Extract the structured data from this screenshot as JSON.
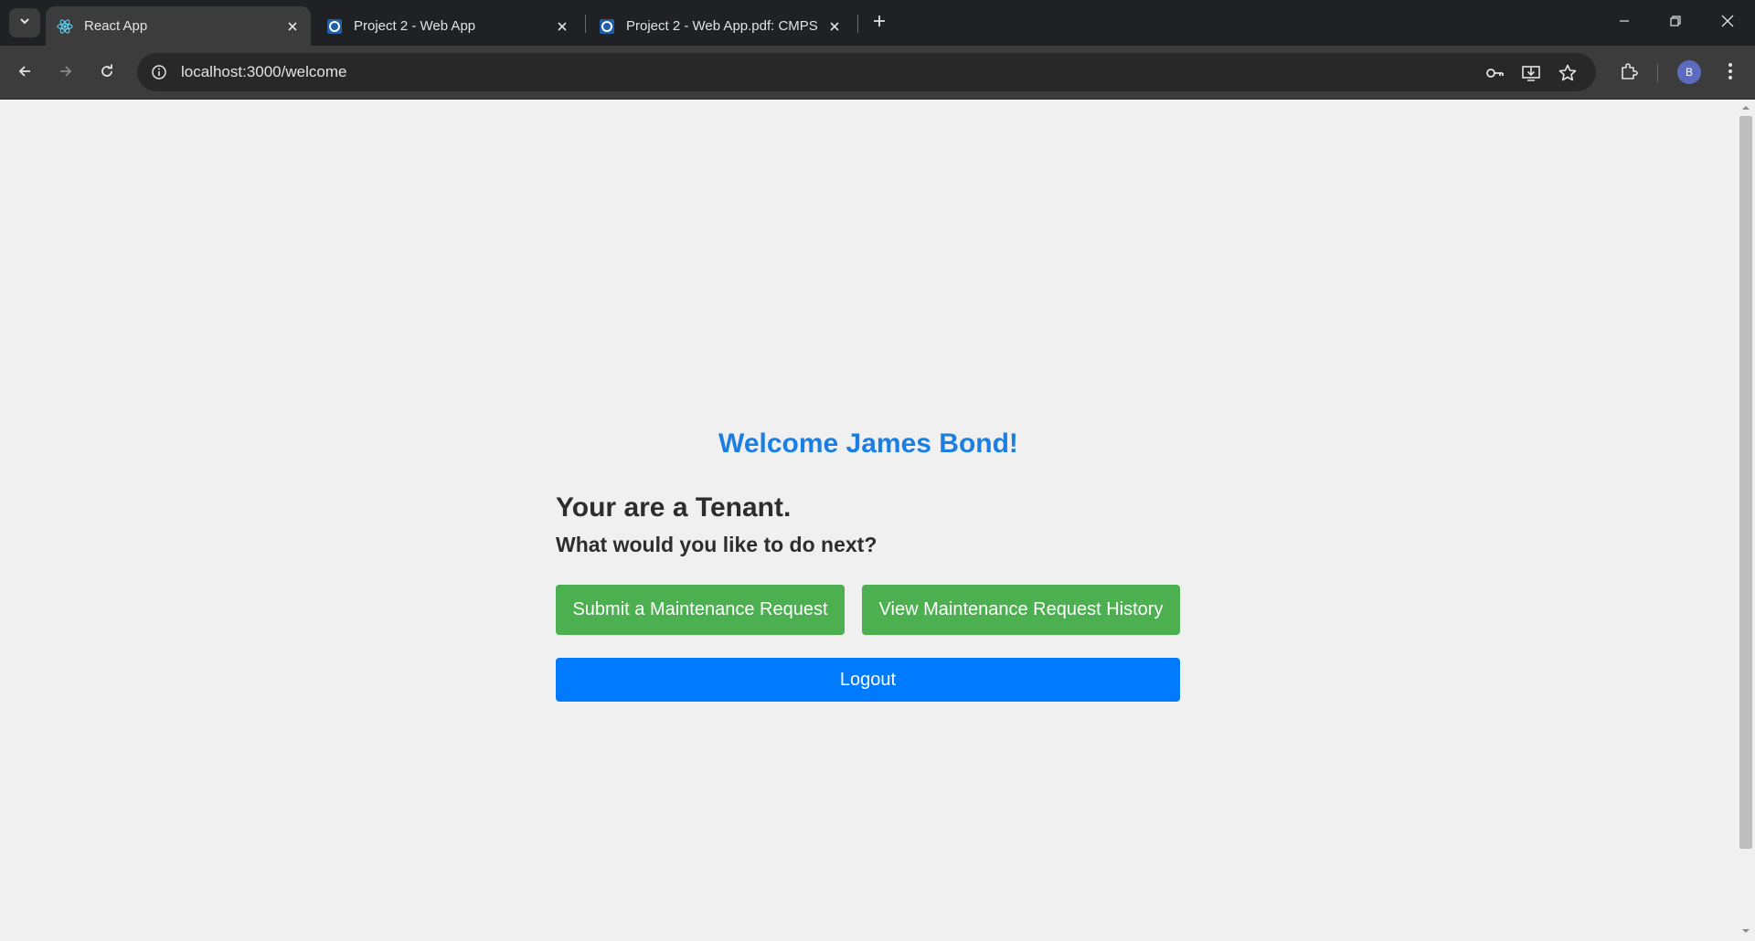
{
  "browser": {
    "tabs": [
      {
        "title": "React App",
        "active": true
      },
      {
        "title": "Project 2 - Web App",
        "active": false
      },
      {
        "title": "Project 2 - Web App.pdf: CMPS",
        "active": false
      }
    ],
    "url": "localhost:3000/welcome",
    "profile_initial": "B",
    "icons": [
      "tab-search-icon",
      "react-icon",
      "close-icon",
      "plus-icon",
      "minimize-icon",
      "restore-icon",
      "back-icon",
      "forward-icon",
      "reload-icon",
      "info-icon",
      "key-icon",
      "install-icon",
      "star-icon",
      "extensions-icon",
      "more-vert-icon"
    ]
  },
  "page": {
    "welcome": "Welcome James Bond!",
    "role": "Your are a Tenant.",
    "prompt": "What would you like to do next?",
    "submit_label": "Submit a Maintenance Request",
    "history_label": "View Maintenance Request History",
    "logout_label": "Logout"
  },
  "colors": {
    "title_blue": "#1b7ee2",
    "button_green": "#4caf50",
    "button_blue": "#007bff",
    "page_bg": "#f0f0f0",
    "chrome_dark": "#202124"
  }
}
